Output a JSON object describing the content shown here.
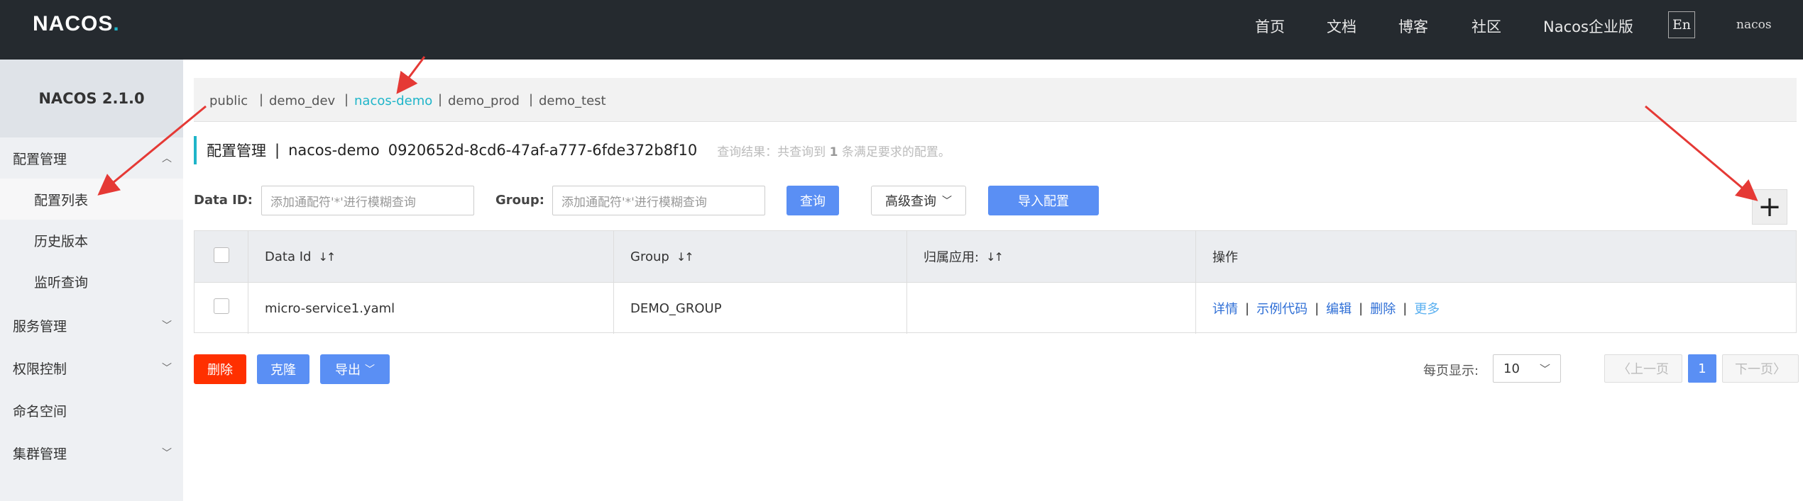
{
  "header": {
    "logo": "NACOS",
    "nav": [
      "首页",
      "文档",
      "博客",
      "社区",
      "Nacos企业版"
    ],
    "lang": "En",
    "user": "nacos"
  },
  "sidebar": {
    "version": "NACOS 2.1.0",
    "items": [
      {
        "label": "配置管理"
      },
      {
        "label": "配置列表"
      },
      {
        "label": "历史版本"
      },
      {
        "label": "监听查询"
      },
      {
        "label": "服务管理"
      },
      {
        "label": "权限控制"
      },
      {
        "label": "命名空间"
      },
      {
        "label": "集群管理"
      }
    ]
  },
  "namespaces": [
    "public",
    "demo_dev",
    "nacos-demo",
    "demo_prod",
    "demo_test"
  ],
  "title": {
    "main": "配置管理",
    "separator": "|",
    "namespace": "nacos-demo",
    "id": "0920652d-8cd6-47af-a777-6fde372b8f10",
    "hint_prefix": "查询结果：共查询到",
    "hint_count": "1",
    "hint_suffix": "条满足要求的配置。"
  },
  "search": {
    "dataid_label": "Data ID:",
    "dataid_placeholder": "添加通配符'*'进行模糊查询",
    "group_label": "Group:",
    "group_placeholder": "添加通配符'*'进行模糊查询",
    "query_btn": "查询",
    "advanced_btn": "高级查询",
    "import_btn": "导入配置"
  },
  "table": {
    "headers": [
      "Data Id",
      "Group",
      "归属应用:",
      "操作"
    ],
    "rows": [
      {
        "data_id": "micro-service1.yaml",
        "group": "DEMO_GROUP",
        "app": "",
        "ops": [
          "详情",
          "示例代码",
          "编辑",
          "删除",
          "更多"
        ]
      }
    ]
  },
  "actions": {
    "delete": "删除",
    "clone": "克隆",
    "export": "导出"
  },
  "pager": {
    "label": "每页显示:",
    "size": "10",
    "prev": "上一页",
    "page": "1",
    "next": "下一页"
  }
}
